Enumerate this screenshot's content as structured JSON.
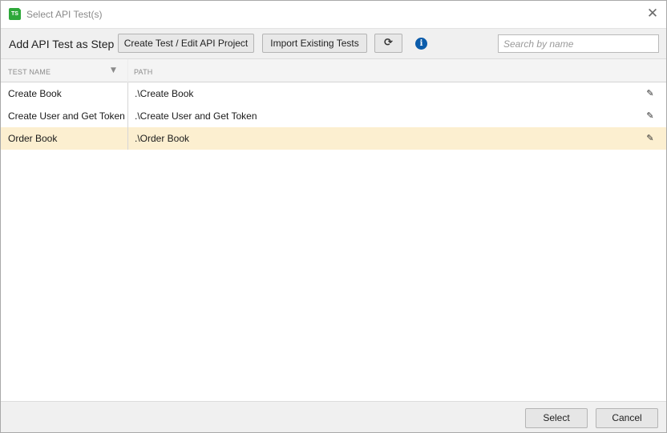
{
  "window": {
    "title": "Select API Test(s)",
    "app_icon_text": "TS",
    "close_glyph": "✕"
  },
  "toolbar": {
    "title": "Add API Test as Step",
    "create_label": "Create Test / Edit API Project",
    "import_label": "Import Existing Tests",
    "refresh_icon": "refresh-icon",
    "refresh_glyph": "⟳",
    "info_glyph": "i"
  },
  "search": {
    "placeholder": "Search by name",
    "value": ""
  },
  "grid": {
    "columns": [
      {
        "label": "TEST NAME"
      },
      {
        "label": "PATH"
      }
    ],
    "filter_glyph": "▼",
    "edit_glyph": "✎",
    "rows": [
      {
        "name": "Create Book",
        "path": ".\\Create Book",
        "selected": false
      },
      {
        "name": "Create User and Get Token",
        "path": ".\\Create User and Get Token",
        "selected": false
      },
      {
        "name": "Order Book",
        "path": ".\\Order Book",
        "selected": true
      }
    ]
  },
  "footer": {
    "select_label": "Select",
    "cancel_label": "Cancel"
  },
  "colors": {
    "selected_row": "#fcefd0",
    "app_icon": "#2ea83a",
    "info_icon": "#0b5cab"
  }
}
